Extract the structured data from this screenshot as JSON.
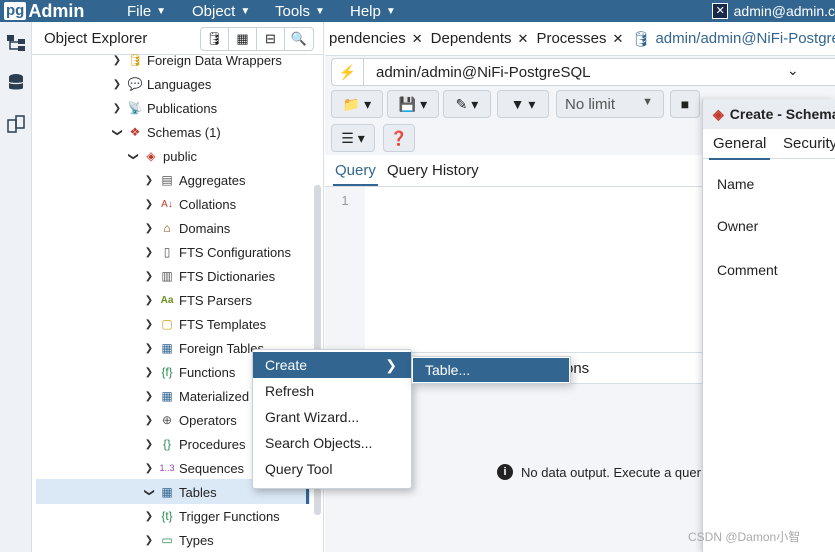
{
  "topbar": {
    "logo_pg": "pg",
    "logo_admin": "Admin",
    "menu": [
      "File",
      "Object",
      "Tools",
      "Help"
    ],
    "user": "admin@admin.c"
  },
  "explorer": {
    "title": "Object Explorer",
    "tree": [
      {
        "label": "Foreign Data Wrappers",
        "icon": "foreign-data-wrapper-icon"
      },
      {
        "label": "Languages",
        "icon": "language-icon"
      },
      {
        "label": "Publications",
        "icon": "publication-icon"
      },
      {
        "label": "Schemas (1)",
        "icon": "schemas-icon"
      },
      {
        "label": "public",
        "icon": "schema-icon"
      },
      {
        "label": "Aggregates",
        "icon": "aggregate-icon"
      },
      {
        "label": "Collations",
        "icon": "collation-icon"
      },
      {
        "label": "Domains",
        "icon": "domain-icon"
      },
      {
        "label": "FTS Configurations",
        "icon": "fts-config-icon"
      },
      {
        "label": "FTS Dictionaries",
        "icon": "fts-dictionary-icon"
      },
      {
        "label": "FTS Parsers",
        "icon": "fts-parser-icon"
      },
      {
        "label": "FTS Templates",
        "icon": "fts-template-icon"
      },
      {
        "label": "Foreign Tables",
        "icon": "foreign-table-icon"
      },
      {
        "label": "Functions",
        "icon": "function-icon"
      },
      {
        "label": "Materialized",
        "icon": "materialized-view-icon"
      },
      {
        "label": "Operators",
        "icon": "operator-icon"
      },
      {
        "label": "Procedures",
        "icon": "procedure-icon"
      },
      {
        "label": "Sequences",
        "icon": "sequence-icon"
      },
      {
        "label": "Tables",
        "icon": "table-icon"
      },
      {
        "label": "Trigger Functions",
        "icon": "trigger-function-icon"
      },
      {
        "label": "Types",
        "icon": "type-icon"
      }
    ]
  },
  "tabs": [
    {
      "label": "pendencies"
    },
    {
      "label": "Dependents"
    },
    {
      "label": "Processes"
    },
    {
      "label": "admin/admin@NiFi-Postgre"
    }
  ],
  "query": {
    "connection": "admin/admin@NiFi-PostgreSQL",
    "limit": "No limit",
    "tab_query": "Query",
    "tab_history": "Query History",
    "line_number": "1",
    "output_tab": "ons",
    "no_data": "No data output. Execute a quer"
  },
  "dialog": {
    "title": "Create - Schema",
    "tab_general": "General",
    "tab_security": "Security",
    "field_name": "Name",
    "field_owner": "Owner",
    "field_comment": "Comment"
  },
  "context_menu": {
    "items": [
      "Create",
      "Refresh",
      "Grant Wizard...",
      "Search Objects...",
      "Query Tool"
    ],
    "submenu": "Table..."
  },
  "watermark": "CSDN @Damon小智",
  "colors": {
    "brand": "#326690",
    "highlight": "#326690",
    "selection": "#dbe8f6"
  }
}
